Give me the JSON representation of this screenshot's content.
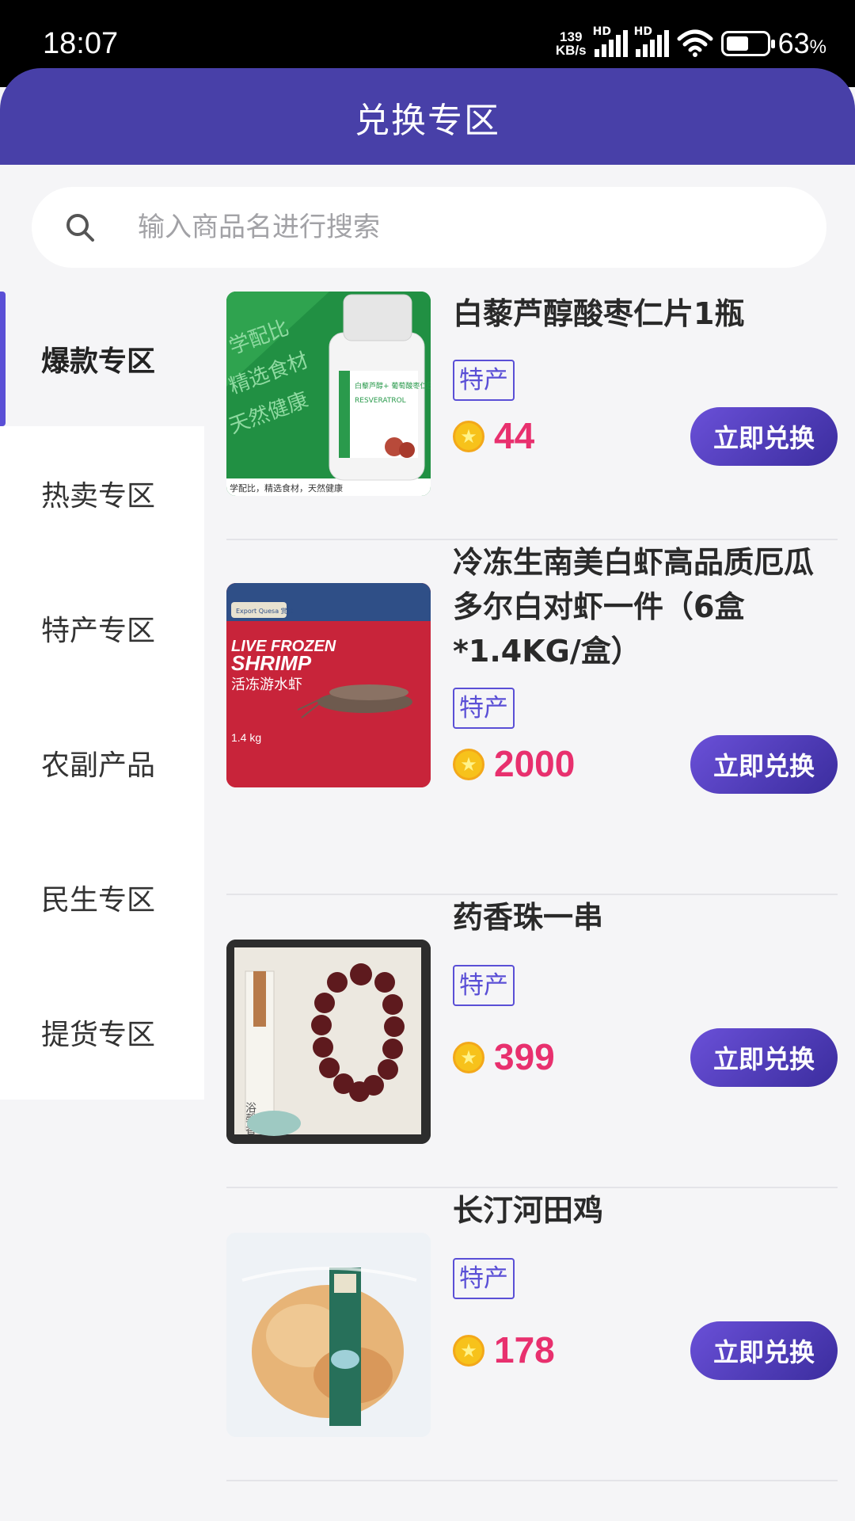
{
  "status_bar": {
    "time": "18:07",
    "net_speed_value": "139",
    "net_speed_unit": "KB/s",
    "signal_1": "HD",
    "signal_2": "HD",
    "battery_pct": "63",
    "battery_unit": "%"
  },
  "header": {
    "title": "兑换专区"
  },
  "search": {
    "placeholder": "输入商品名进行搜索",
    "value": ""
  },
  "sidebar": {
    "active_index": 0,
    "items": [
      {
        "label": "爆款专区"
      },
      {
        "label": "热卖专区"
      },
      {
        "label": "特产专区"
      },
      {
        "label": "农副产品"
      },
      {
        "label": "民生专区"
      },
      {
        "label": "提货专区"
      }
    ]
  },
  "products": [
    {
      "name": "白藜芦醇酸枣仁片1瓶",
      "tag": "特产",
      "price": "44",
      "button": "立即兑换",
      "image_text": "学配比 精选食材 天然健康",
      "image_caption": "学配比，精选食材，天然健康",
      "bottle_label": "白藜芦醇+ 葡萄酸枣仁压片糖果",
      "bottle_sub": "RESVERATROL"
    },
    {
      "name": "冷冻生南美白虾高品质厄瓜多尔白对虾一件（6盒*1.4KG/盒）",
      "tag": "特产",
      "price": "2000",
      "button": "立即兑换",
      "image_title": "LIVE FROZEN",
      "image_title2": "SHRIMP",
      "image_sub": "活冻游水虾",
      "image_weight": "1.4 kg",
      "image_brand": "Export Quesa 赏仕"
    },
    {
      "name": "药香珠一串",
      "tag": "特产",
      "price": "399",
      "button": "立即兑换",
      "image_text": "浴馨香"
    },
    {
      "name": "长汀河田鸡",
      "tag": "特产",
      "price": "178",
      "button": "立即兑换"
    }
  ],
  "colors": {
    "header_bg": "#4840a8",
    "accent": "#5a4fd6",
    "price": "#e8306e",
    "coin": "#f7c21b"
  }
}
